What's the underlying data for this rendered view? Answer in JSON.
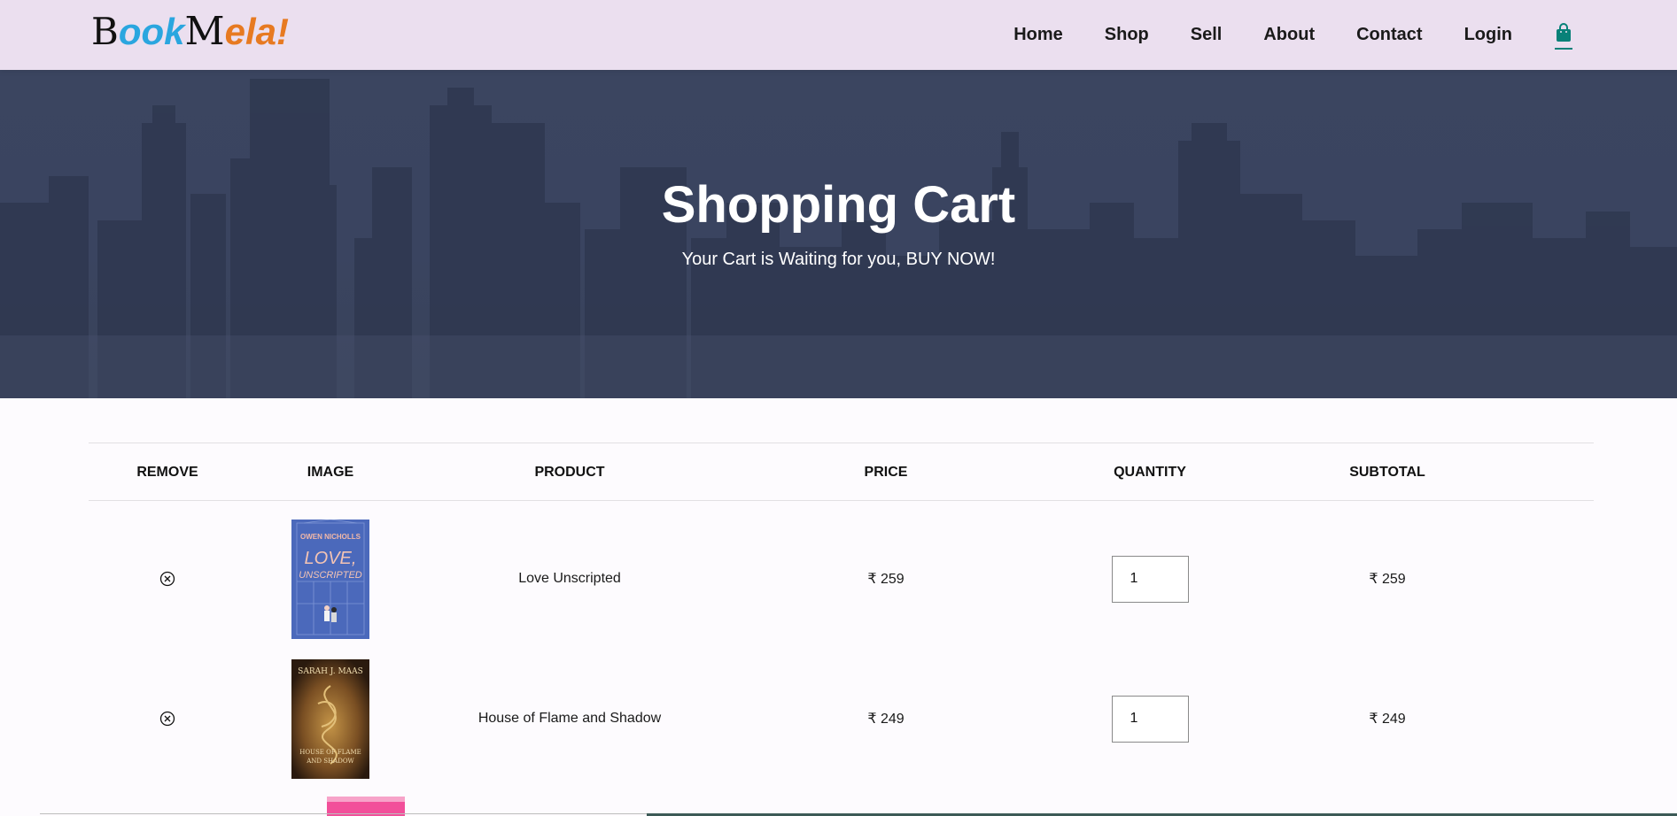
{
  "brand": {
    "letter_b": "B",
    "part1": "ook",
    "letter_m": "M",
    "part2": "ela!"
  },
  "nav": {
    "items": [
      {
        "label": "Home"
      },
      {
        "label": "Shop"
      },
      {
        "label": "Sell"
      },
      {
        "label": "About"
      },
      {
        "label": "Contact"
      },
      {
        "label": "Login"
      }
    ],
    "cart_icon": "shopping-bag-icon",
    "accent_color": "#088178"
  },
  "hero": {
    "title": "Shopping Cart",
    "subtitle": "Your Cart is Waiting for you, BUY NOW!"
  },
  "cart": {
    "headers": [
      "Remove",
      "Image",
      "Product",
      "Price",
      "Quantity",
      "Subtotal"
    ],
    "rows": [
      {
        "remove_icon": "close-circle-icon",
        "cover_author": "OWEN NICHOLLS",
        "cover_title_1": "LOVE,",
        "cover_title_2": "UNSCRIPTED",
        "product": "Love Unscripted",
        "price": "₹ 259",
        "quantity": "1",
        "subtotal": "₹ 259"
      },
      {
        "remove_icon": "close-circle-icon",
        "cover_author": "SARAH J. MAAS",
        "cover_title_1": "HOUSE OF FLAME",
        "cover_title_2": "AND SHADOW",
        "product": "House of Flame and Shadow",
        "price": "₹ 249",
        "quantity": "1",
        "subtotal": "₹ 249"
      }
    ]
  }
}
